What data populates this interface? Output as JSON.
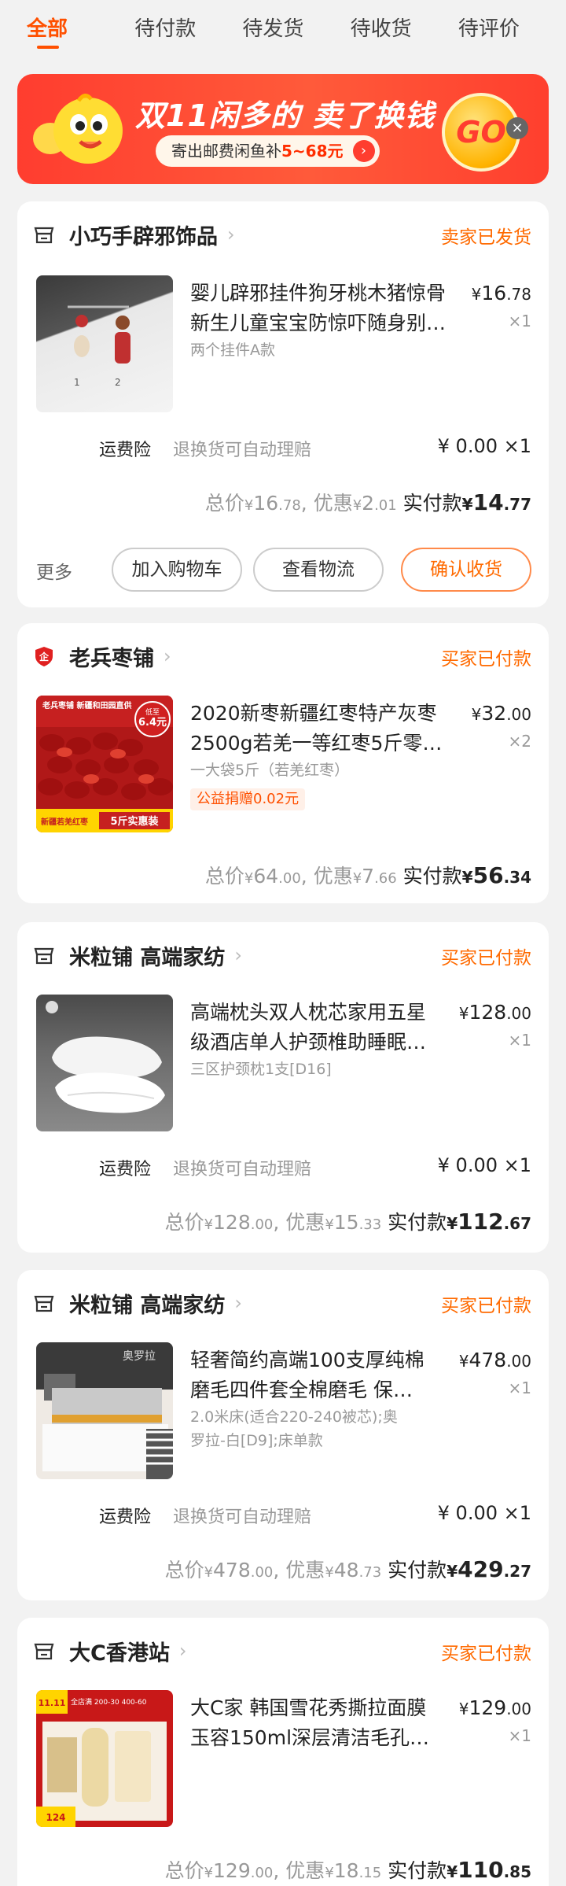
{
  "tabs": [
    "全部",
    "待付款",
    "待发货",
    "待收货",
    "待评价"
  ],
  "banner": {
    "title": "双11闲多的 卖了换钱",
    "pill_prefix": "寄出邮费闲鱼补",
    "pill_amount": "5~68元",
    "go_label": "GO",
    "close_glyph": "×"
  },
  "orders": [
    {
      "shop": "小巧手辟邪饰品",
      "status": "卖家已发货",
      "title_lines": [
        "婴儿辟邪挂件狗牙桃木猪惊骨",
        "新生儿童宝宝防惊吓随身别…"
      ],
      "spec": "两个挂件A款",
      "price_int": "16",
      "price_dec": ".78",
      "qty": "×1",
      "insurance": {
        "label": "运费险",
        "desc": "退换货可自动理赔",
        "value": "¥ 0.00 ×1"
      },
      "total": {
        "label": "总价",
        "int": "16",
        "dec": ".78",
        "discount_label": "优惠",
        "discount_int": "2",
        "discount_dec": ".01",
        "paid_label": "实付款",
        "paid_int": "14",
        "paid_dec": ".77"
      },
      "actions": {
        "more": "更多",
        "cart": "加入购物车",
        "logistics": "查看物流",
        "confirm": "确认收货"
      }
    },
    {
      "shop": "老兵枣铺",
      "status": "买家已付款",
      "title_lines": [
        "2020新枣新疆红枣特产灰枣",
        "2500g若羌一等红枣5斤零…"
      ],
      "spec": "一大袋5斤（若羌红枣）",
      "charity": "公益捐赠0.02元",
      "price_int": "32",
      "price_dec": ".00",
      "qty": "×2",
      "total": {
        "label": "总价",
        "int": "64",
        "dec": ".00",
        "discount_label": "优惠",
        "discount_int": "7",
        "discount_dec": ".66",
        "paid_label": "实付款",
        "paid_int": "56",
        "paid_dec": ".34"
      },
      "thumb_text": {
        "top": "老兵枣铺 新疆和田园直供",
        "badge_top": "低至",
        "badge": "6.4元",
        "bottom": "新疆若羌红枣",
        "bottom2": "5斤实惠装"
      }
    },
    {
      "shop": "米粒铺 高端家纺",
      "status": "买家已付款",
      "title_lines": [
        "高端枕头双人枕芯家用五星",
        "级酒店单人护颈椎助睡眠…"
      ],
      "spec": "三区护颈枕1支[D16]",
      "price_int": "128",
      "price_dec": ".00",
      "qty": "×1",
      "insurance": {
        "label": "运费险",
        "desc": "退换货可自动理赔",
        "value": "¥ 0.00 ×1"
      },
      "total": {
        "label": "总价",
        "int": "128",
        "dec": ".00",
        "discount_label": "优惠",
        "discount_int": "15",
        "discount_dec": ".33",
        "paid_label": "实付款",
        "paid_int": "112",
        "paid_dec": ".67"
      }
    },
    {
      "shop": "米粒铺 高端家纺",
      "status": "买家已付款",
      "title_lines": [
        "轻奢简约高端100支厚纯棉",
        "磨毛四件套全棉磨毛 保…"
      ],
      "spec_lines": [
        "2.0米床(适合220-240被芯);奥",
        "罗拉-白[D9];床单款"
      ],
      "price_int": "478",
      "price_dec": ".00",
      "qty": "×1",
      "insurance": {
        "label": "运费险",
        "desc": "退换货可自动理赔",
        "value": "¥ 0.00 ×1"
      },
      "total": {
        "label": "总价",
        "int": "478",
        "dec": ".00",
        "discount_label": "优惠",
        "discount_int": "48",
        "discount_dec": ".73",
        "paid_label": "实付款",
        "paid_int": "429",
        "paid_dec": ".27"
      },
      "thumb_text": "奥罗拉"
    },
    {
      "shop": "大C香港站",
      "status": "买家已付款",
      "title_lines": [
        "大C家  韩国雪花秀撕拉面膜",
        "玉容150ml深层清洁毛孔…"
      ],
      "price_int": "129",
      "price_dec": ".00",
      "qty": "×1",
      "total": {
        "label": "总价",
        "int": "129",
        "dec": ".00",
        "discount_label": "优惠",
        "discount_int": "18",
        "discount_dec": ".15",
        "paid_label": "实付款",
        "paid_int": "110",
        "paid_dec": ".85"
      },
      "thumb_text": {
        "tag": "11.11",
        "deal": "全店满 200-30 400-60",
        "price": "124"
      }
    }
  ],
  "currency": "¥",
  "colors": {
    "accent": "#ff5000",
    "status": "#ff6a00",
    "banner": "#ff3d2f"
  }
}
